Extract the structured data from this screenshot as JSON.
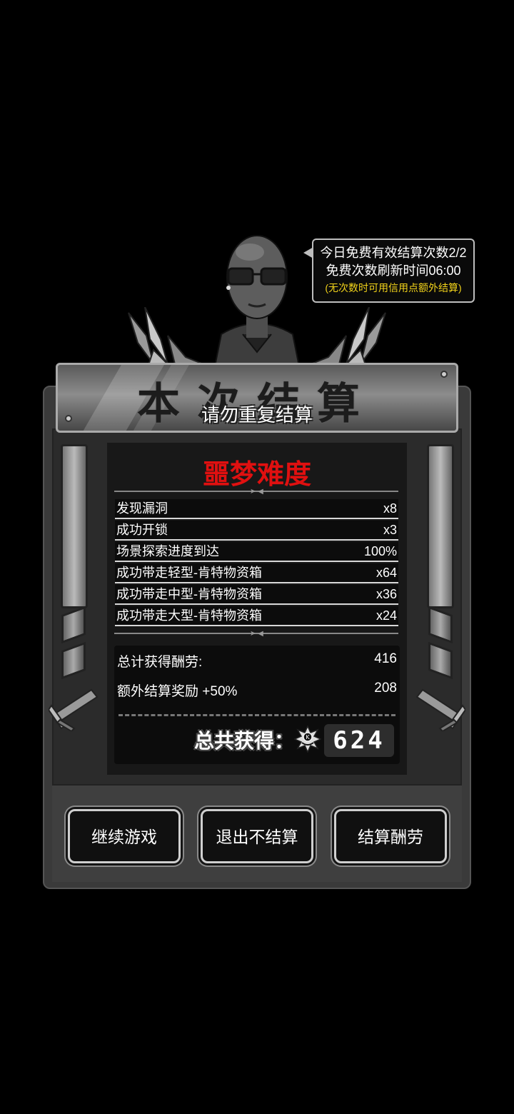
{
  "tooltip": {
    "line1": "今日免费有效结算次数2/2",
    "line2": "免费次数刷新时间06:00",
    "line3": "(无次数时可用信用点额外结算)"
  },
  "header": {
    "title": "本次结算",
    "subtitle": "请勿重复结算"
  },
  "difficulty": "噩梦难度",
  "stats": [
    {
      "label": "发现漏洞",
      "value": "x8"
    },
    {
      "label": "成功开锁",
      "value": "x3"
    },
    {
      "label": "场景探索进度到达",
      "value": "100%"
    },
    {
      "label": "成功带走轻型-肯特物资箱",
      "value": "x64"
    },
    {
      "label": "成功带走中型-肯特物资箱",
      "value": "x36"
    },
    {
      "label": "成功带走大型-肯特物资箱",
      "value": "x24"
    }
  ],
  "totals": {
    "earned_label": "总计获得酬劳:",
    "earned_value": "416",
    "bonus_label": "额外结算奖励 +50%",
    "bonus_value": "208",
    "grand_label": "总共获得：",
    "grand_value": "624"
  },
  "buttons": {
    "continue": "继续游戏",
    "exit": "退出不结算",
    "settle": "结算酬劳"
  },
  "colors": {
    "difficulty": "#e01010",
    "tooltip_note": "#f2d31a"
  },
  "icons": {
    "coin": "k-emblem-coin-icon"
  }
}
